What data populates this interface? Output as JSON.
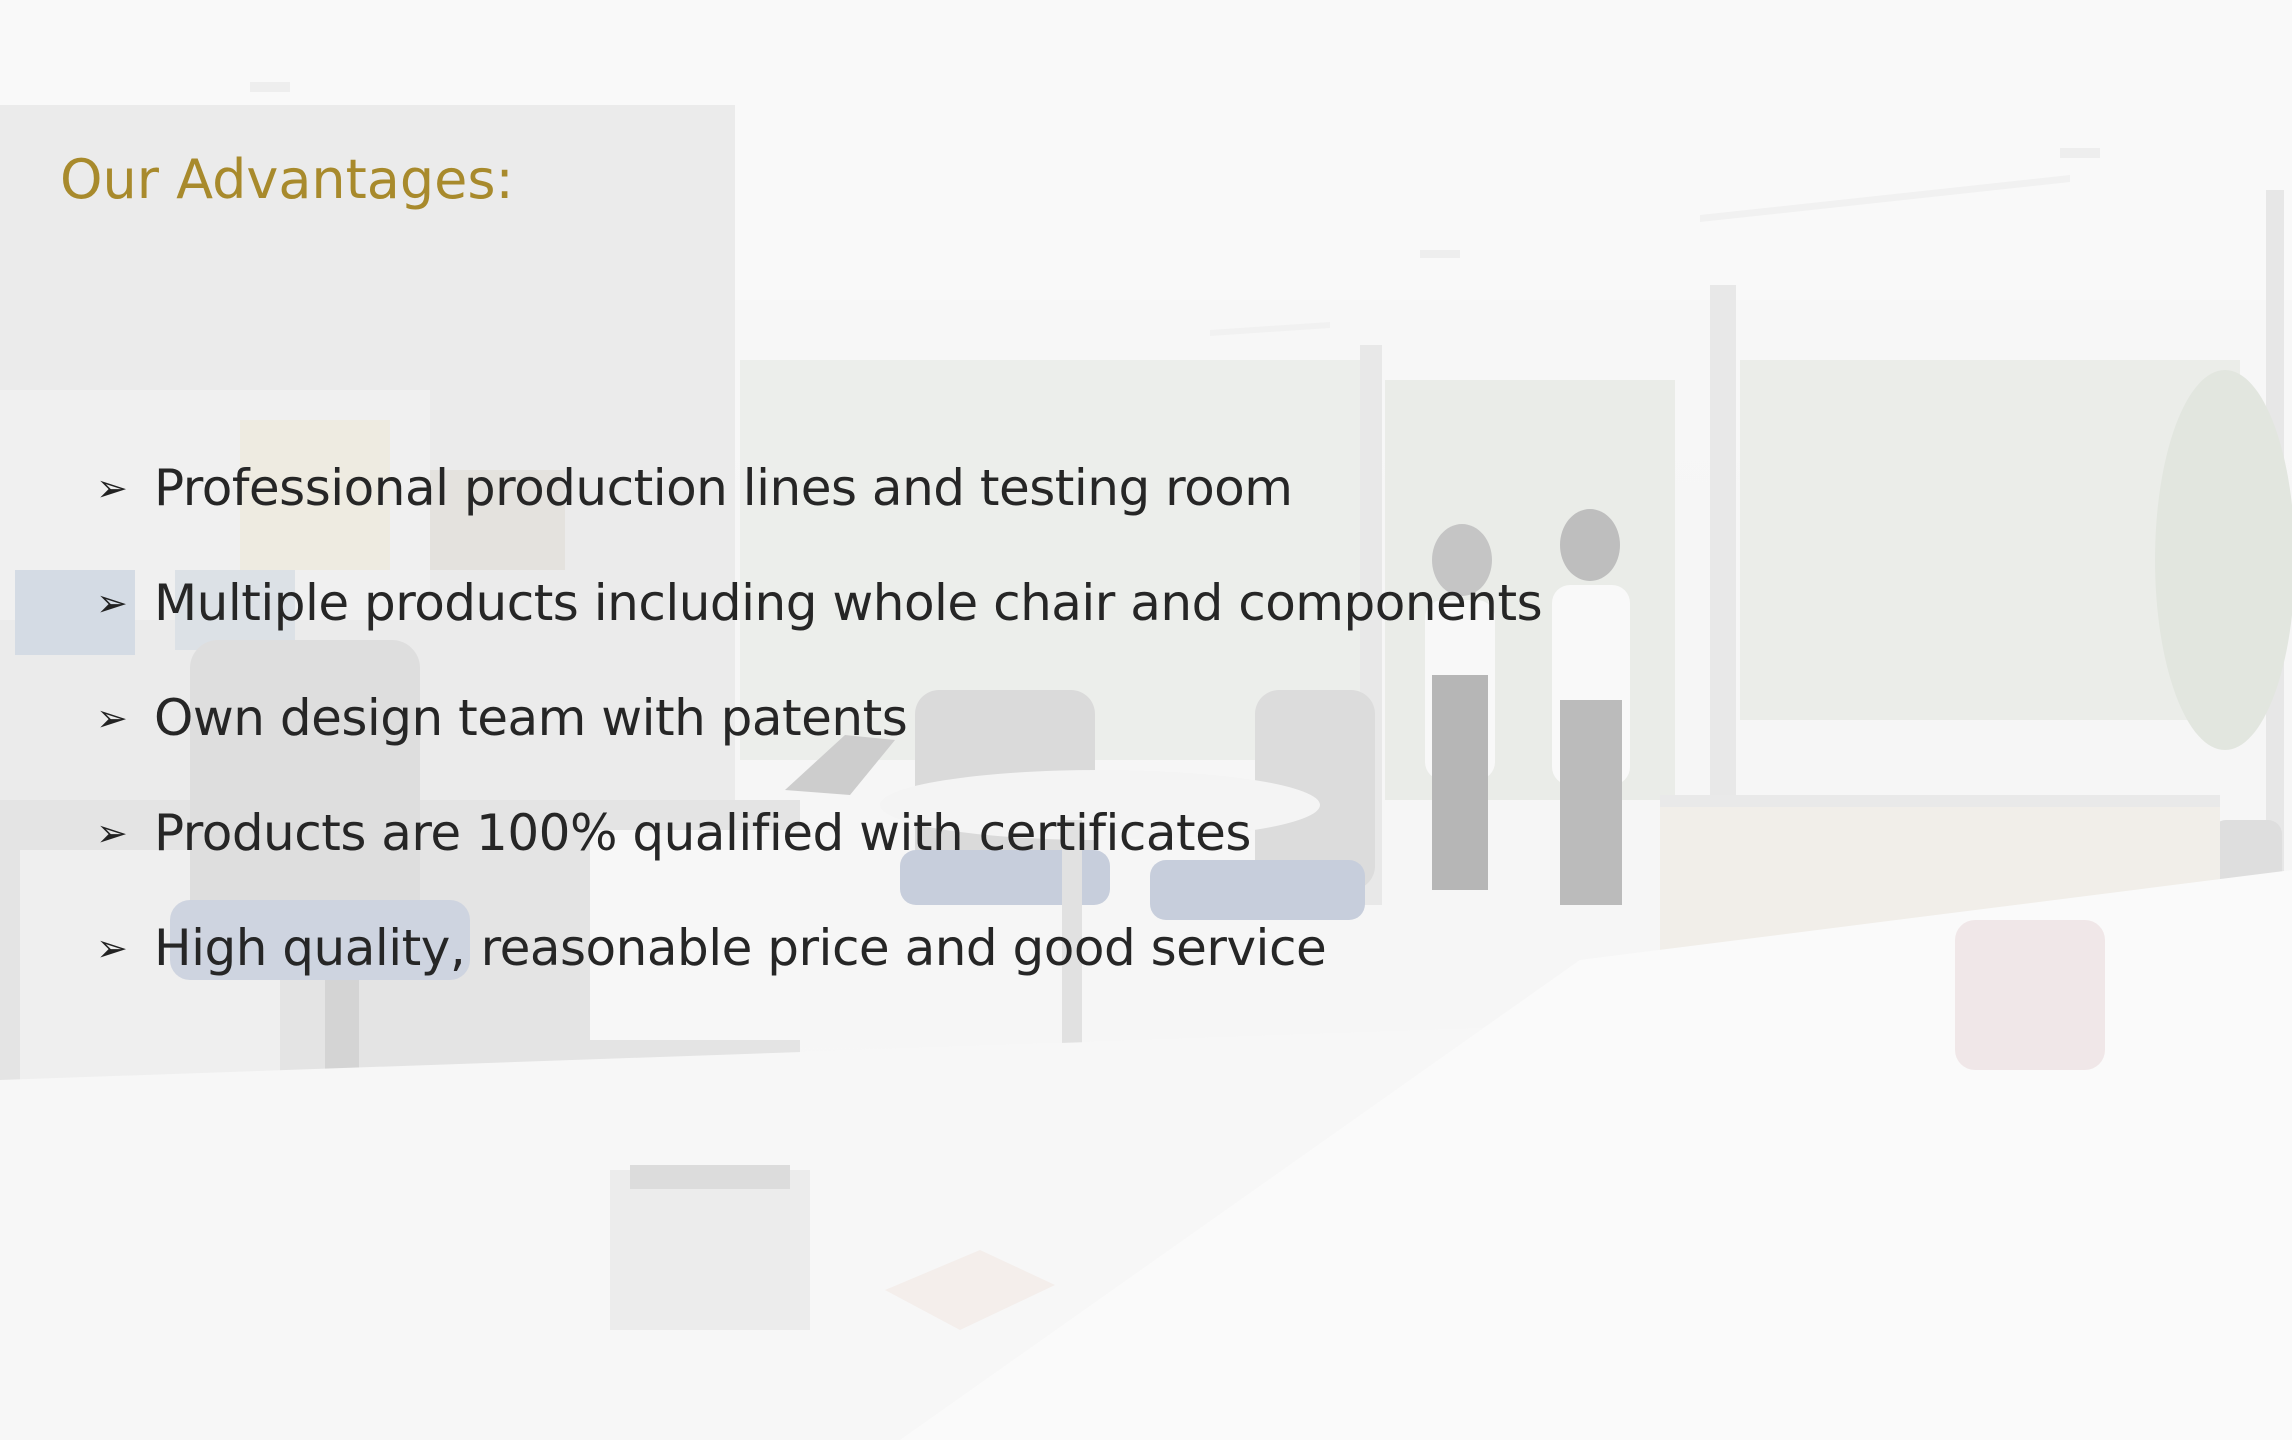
{
  "slide": {
    "title": "Our Advantages:",
    "bullet_marker": "➢",
    "bullets": [
      "Professional production lines and testing room",
      "Multiple products including whole chair and components",
      "Own design team with patents",
      "Products are 100% qualified with certificates",
      "High quality, reasonable price and good service"
    ]
  },
  "colors": {
    "title": "#a88a2c",
    "text": "#262626"
  }
}
